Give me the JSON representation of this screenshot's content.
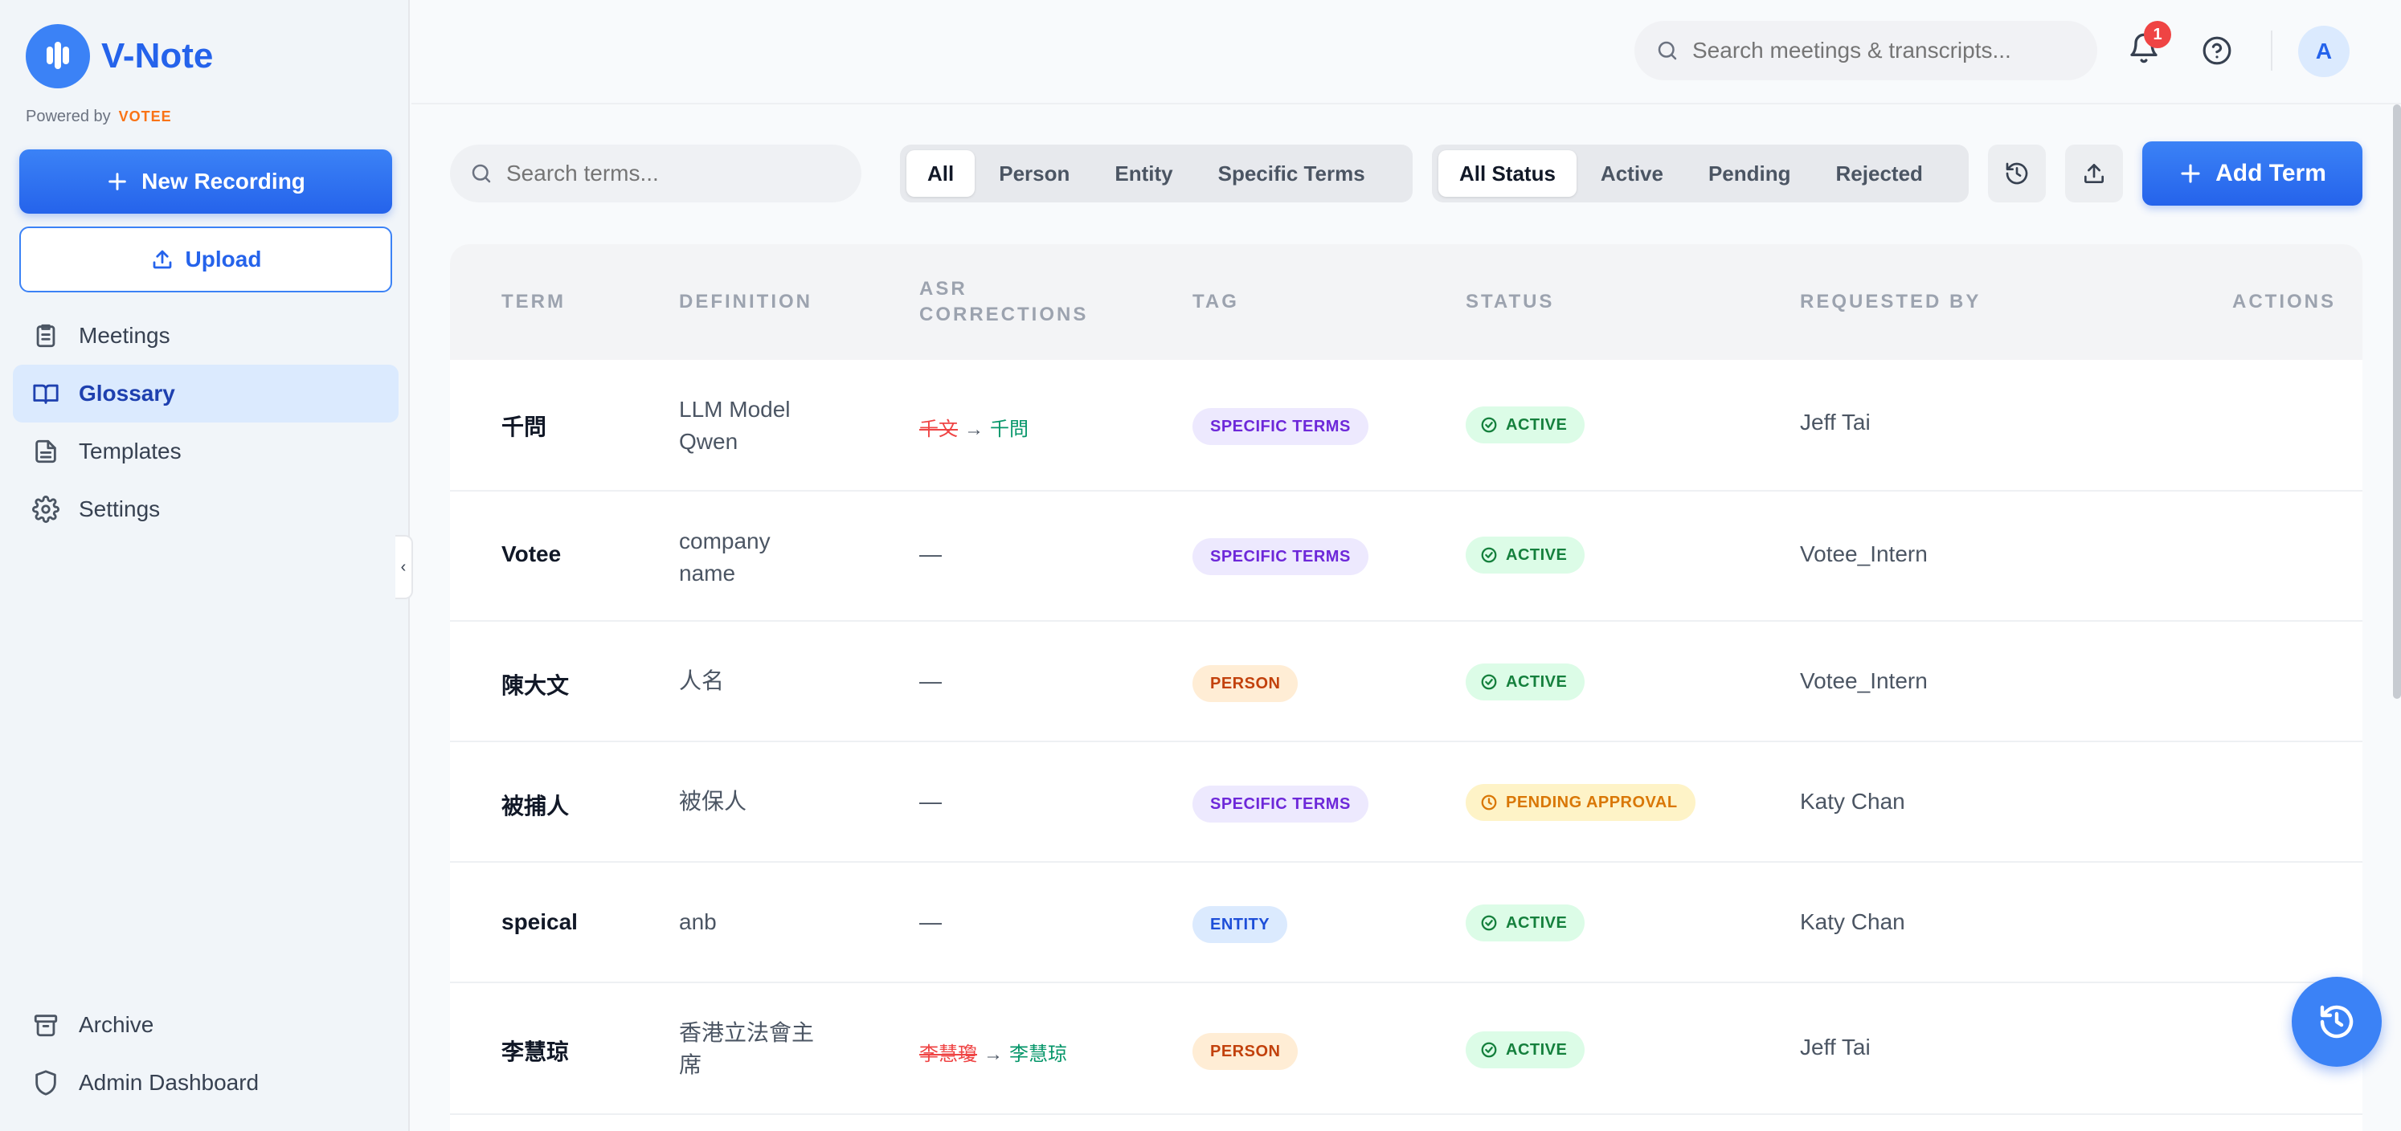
{
  "app": {
    "name": "V-Note",
    "powered_by": "Powered by",
    "powered_brand": "VOTEE"
  },
  "sidebar": {
    "new_recording": "New Recording",
    "upload": "Upload",
    "items": [
      {
        "label": "Meetings",
        "icon": "clipboard-icon",
        "active": false
      },
      {
        "label": "Glossary",
        "icon": "book-icon",
        "active": true
      },
      {
        "label": "Templates",
        "icon": "document-icon",
        "active": false
      },
      {
        "label": "Settings",
        "icon": "gear-icon",
        "active": false
      }
    ],
    "bottom_items": [
      {
        "label": "Archive",
        "icon": "archive-icon"
      },
      {
        "label": "Admin Dashboard",
        "icon": "shield-icon"
      }
    ]
  },
  "header": {
    "search_placeholder": "Search meetings & transcripts...",
    "notification_count": "1",
    "avatar_initial": "A"
  },
  "toolbar": {
    "search_placeholder": "Search terms...",
    "type_filters": [
      "All",
      "Person",
      "Entity",
      "Specific Terms"
    ],
    "type_selected": "All",
    "status_filters": [
      "All Status",
      "Active",
      "Pending",
      "Rejected"
    ],
    "status_selected": "All Status",
    "add_term": "Add Term"
  },
  "table": {
    "columns": [
      "TERM",
      "DEFINITION",
      "ASR CORRECTIONS",
      "TAG",
      "STATUS",
      "REQUESTED BY",
      "ACTIONS"
    ],
    "rows": [
      {
        "term": "千問",
        "definition": "LLM Model Qwen",
        "asr_wrong": "千文",
        "asr_right": "千問",
        "tag": "SPECIFIC TERMS",
        "tag_type": "specific",
        "status": "ACTIVE",
        "status_type": "active",
        "requested_by": "Jeff Tai"
      },
      {
        "term": "Votee",
        "definition": "company name",
        "asr_wrong": "",
        "asr_right": "",
        "asr_empty": "—",
        "tag": "SPECIFIC TERMS",
        "tag_type": "specific",
        "status": "ACTIVE",
        "status_type": "active",
        "requested_by": "Votee_Intern"
      },
      {
        "term": "陳大文",
        "definition": "人名",
        "asr_wrong": "",
        "asr_right": "",
        "asr_empty": "—",
        "tag": "PERSON",
        "tag_type": "person",
        "status": "ACTIVE",
        "status_type": "active",
        "requested_by": "Votee_Intern"
      },
      {
        "term": "被捕人",
        "definition": "被保人",
        "asr_wrong": "",
        "asr_right": "",
        "asr_empty": "—",
        "tag": "SPECIFIC TERMS",
        "tag_type": "specific",
        "status": "PENDING APPROVAL",
        "status_type": "pending",
        "requested_by": "Katy Chan"
      },
      {
        "term": "speical",
        "definition": "anb",
        "asr_wrong": "",
        "asr_right": "",
        "asr_empty": "—",
        "tag": "ENTITY",
        "tag_type": "entity",
        "status": "ACTIVE",
        "status_type": "active",
        "requested_by": "Katy Chan"
      },
      {
        "term": "李慧琼",
        "definition": "香港立法會主席",
        "asr_wrong": "李慧瓊",
        "asr_right": "李慧琼",
        "tag": "PERSON",
        "tag_type": "person",
        "status": "ACTIVE",
        "status_type": "active",
        "requested_by": "Jeff Tai"
      }
    ]
  },
  "colors": {
    "accent": "#2563eb",
    "active_status": "#15803d",
    "pending_status": "#d97706"
  }
}
